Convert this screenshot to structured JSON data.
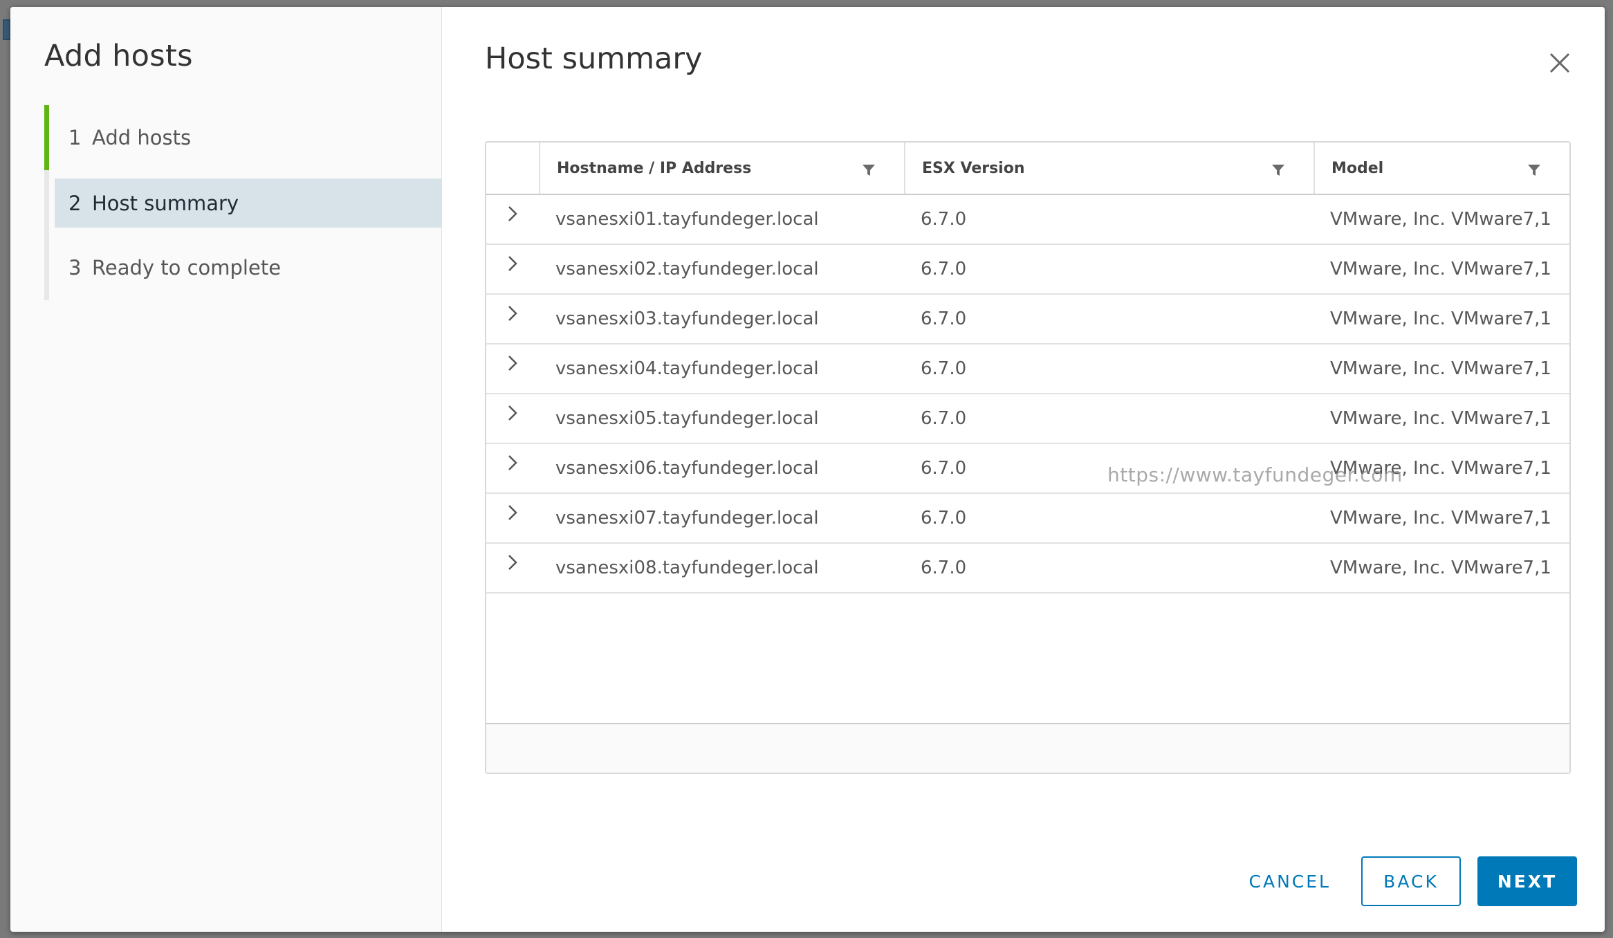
{
  "wizard": {
    "title": "Add hosts",
    "steps": [
      {
        "number": "1",
        "label": "Add hosts",
        "state": "completed"
      },
      {
        "number": "2",
        "label": "Host summary",
        "state": "active"
      },
      {
        "number": "3",
        "label": "Ready to complete",
        "state": "pending"
      }
    ]
  },
  "page": {
    "title": "Host summary",
    "close_icon": "close-icon"
  },
  "grid": {
    "columns": [
      {
        "label": "Hostname / IP Address",
        "filter_icon": "filter-icon"
      },
      {
        "label": "ESX Version",
        "filter_icon": "filter-icon"
      },
      {
        "label": "Model",
        "filter_icon": "filter-icon"
      }
    ],
    "rows": [
      {
        "hostname": "vsanesxi01.tayfundeger.local",
        "version": "6.7.0",
        "model": "VMware, Inc. VMware7,1"
      },
      {
        "hostname": "vsanesxi02.tayfundeger.local",
        "version": "6.7.0",
        "model": "VMware, Inc. VMware7,1"
      },
      {
        "hostname": "vsanesxi03.tayfundeger.local",
        "version": "6.7.0",
        "model": "VMware, Inc. VMware7,1"
      },
      {
        "hostname": "vsanesxi04.tayfundeger.local",
        "version": "6.7.0",
        "model": "VMware, Inc. VMware7,1"
      },
      {
        "hostname": "vsanesxi05.tayfundeger.local",
        "version": "6.7.0",
        "model": "VMware, Inc. VMware7,1"
      },
      {
        "hostname": "vsanesxi06.tayfundeger.local",
        "version": "6.7.0",
        "model": "VMware, Inc. VMware7,1"
      },
      {
        "hostname": "vsanesxi07.tayfundeger.local",
        "version": "6.7.0",
        "model": "VMware, Inc. VMware7,1"
      },
      {
        "hostname": "vsanesxi08.tayfundeger.local",
        "version": "6.7.0",
        "model": "VMware, Inc. VMware7,1"
      }
    ]
  },
  "watermark": "https://www.tayfundeger.com",
  "footer": {
    "cancel_label": "CANCEL",
    "back_label": "BACK",
    "next_label": "NEXT"
  },
  "colors": {
    "primary": "#0079b8",
    "completed_step": "#60b515",
    "active_step_bg": "#d8e3e9"
  }
}
